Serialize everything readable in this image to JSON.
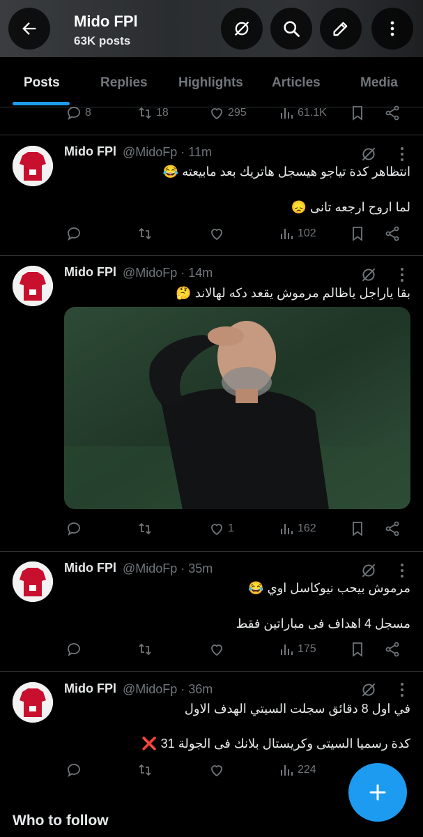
{
  "header": {
    "title": "Mido FPl",
    "subtitle": "63K posts",
    "back_icon": "arrow-left-icon",
    "actions": [
      "grok-icon",
      "search-icon",
      "edit-icon",
      "more-vertical-icon"
    ]
  },
  "tabs": [
    {
      "label": "Posts",
      "active": true
    },
    {
      "label": "Replies",
      "active": false
    },
    {
      "label": "Highlights",
      "active": false
    },
    {
      "label": "Articles",
      "active": false
    },
    {
      "label": "Media",
      "active": false
    }
  ],
  "partial_tweet": {
    "replies": "8",
    "reposts": "18",
    "likes": "295",
    "views": "61.1K"
  },
  "tweets": [
    {
      "name": "Mido FPl",
      "handle": "@MidoFp · 11m",
      "lines": [
        "انتظاهر كدة تياجو هيسجل هاتريك بعد مابيعته 😂",
        "لما اروح ارجعه تانى 😞"
      ],
      "replies": "",
      "reposts": "",
      "likes": "",
      "views": "102"
    },
    {
      "name": "Mido FPl",
      "handle": "@MidoFp · 14m",
      "lines": [
        "بقا ياراجل ياظالم مرموش يقعد دكه لهالاند 🤔"
      ],
      "has_media": true,
      "replies": "",
      "reposts": "",
      "likes": "1",
      "views": "162"
    },
    {
      "name": "Mido FPl",
      "handle": "@MidoFp · 35m",
      "lines": [
        "مرموش بيحب نيوكاسل اوي 😂",
        "مسجل 4 اهداف فى مباراتين فقط"
      ],
      "replies": "",
      "reposts": "",
      "likes": "",
      "views": "175"
    },
    {
      "name": "Mido FPl",
      "handle": "@MidoFp · 36m",
      "lines": [
        "في اول 8 دقائق سجلت السيتي الهدف الاول",
        "كدة رسميا السيتى وكريستال بلانك فى الجولة 31 ❌"
      ],
      "replies": "",
      "reposts": "",
      "likes": "",
      "views": "224"
    }
  ],
  "who_to_follow": "Who to follow",
  "fab_icon": "plus-icon",
  "colors": {
    "accent": "#1d9bf0",
    "text": "#e7e9ea",
    "muted": "#71767b",
    "divider": "#2f3336",
    "background": "#000000"
  }
}
